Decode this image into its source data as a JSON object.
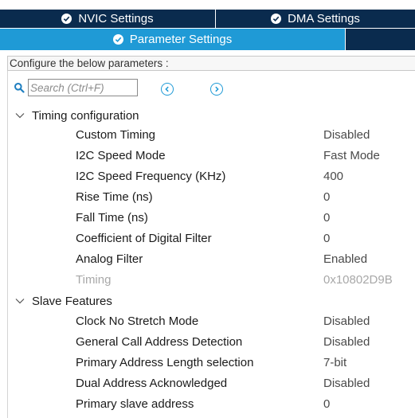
{
  "tabs": {
    "nvic": "NVIC Settings",
    "dma": "DMA Settings",
    "parameter": "Parameter Settings"
  },
  "hint": "Configure the below parameters :",
  "search": {
    "placeholder": "Search (Ctrl+F)"
  },
  "groups": [
    {
      "label": "Timing configuration",
      "params": [
        {
          "name": "Custom Timing",
          "value": "Disabled"
        },
        {
          "name": "I2C Speed Mode",
          "value": "Fast Mode"
        },
        {
          "name": "I2C Speed Frequency (KHz)",
          "value": "400"
        },
        {
          "name": "Rise Time (ns)",
          "value": "0"
        },
        {
          "name": "Fall Time (ns)",
          "value": "0"
        },
        {
          "name": "Coefficient of Digital Filter",
          "value": "0"
        },
        {
          "name": "Analog Filter",
          "value": "Enabled"
        },
        {
          "name": "Timing",
          "value": "0x10802D9B"
        }
      ]
    },
    {
      "label": "Slave Features",
      "params": [
        {
          "name": "Clock No Stretch Mode",
          "value": "Disabled"
        },
        {
          "name": "General Call Address Detection",
          "value": "Disabled"
        },
        {
          "name": "Primary Address Length selection",
          "value": "7-bit"
        },
        {
          "name": "Dual Address Acknowledged",
          "value": "Disabled"
        },
        {
          "name": "Primary slave address",
          "value": "0"
        }
      ]
    }
  ],
  "colors": {
    "tab_dark": "#0a2b4e",
    "tab_active": "#1f9ad6",
    "disabled_text": "#a8a8a8"
  }
}
